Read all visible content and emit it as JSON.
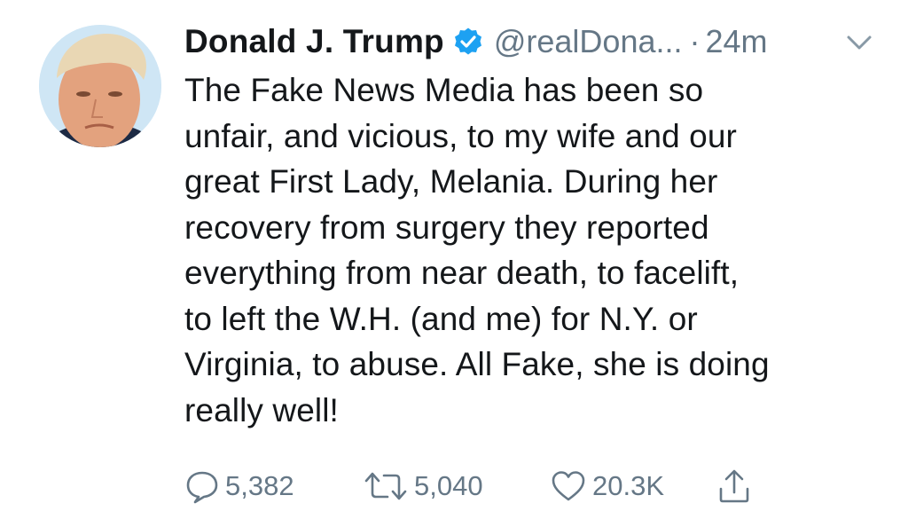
{
  "tweet": {
    "author_name": "Donald J. Trump",
    "handle": "@realDona...",
    "separator": "·",
    "time": "24m",
    "text": "The Fake News Media has been so\nunfair, and vicious, to my wife and our\ngreat First Lady, Melania. During her\nrecovery from surgery they reported\neverything from near death, to facelift,\nto left the W.H. (and me) for N.Y. or\nVirginia, to abuse. All Fake, she is doing\nreally well!"
  },
  "actions": {
    "reply_count": "5,382",
    "retweet_count": "5,040",
    "like_count": "20.3K"
  },
  "icons": {
    "verified": "verified-badge-icon",
    "menu": "chevron-down-icon",
    "reply": "reply-icon",
    "retweet": "retweet-icon",
    "like": "heart-icon",
    "share": "share-icon"
  },
  "colors": {
    "text": "#14171a",
    "muted": "#657786",
    "verified_blue": "#1da1f2"
  }
}
